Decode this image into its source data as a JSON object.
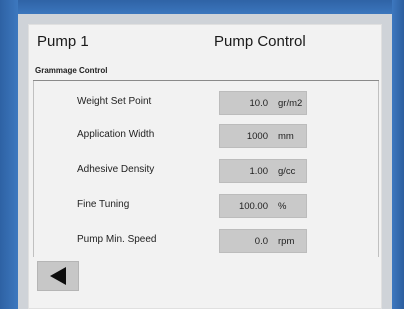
{
  "header": {
    "title": "Pump 1",
    "subtitle": "Pump Control"
  },
  "section": {
    "label": "Grammage Control"
  },
  "rows": [
    {
      "label": "Weight Set Point",
      "value": "10.0",
      "unit": "gr/m2"
    },
    {
      "label": "Application Width",
      "value": "1000",
      "unit": "mm"
    },
    {
      "label": "Adhesive Density",
      "value": "1.00",
      "unit": "g/cc"
    },
    {
      "label": "Fine Tuning",
      "value": "100.00",
      "unit": "%"
    },
    {
      "label": "Pump Min. Speed",
      "value": "0.0",
      "unit": "rpm"
    }
  ],
  "nav": {
    "back_icon": "left-arrow-icon"
  },
  "colors": {
    "bezel": "#3a72b8",
    "screen_bg": "#f2f2f2",
    "field_bg": "#c9c9c9"
  }
}
